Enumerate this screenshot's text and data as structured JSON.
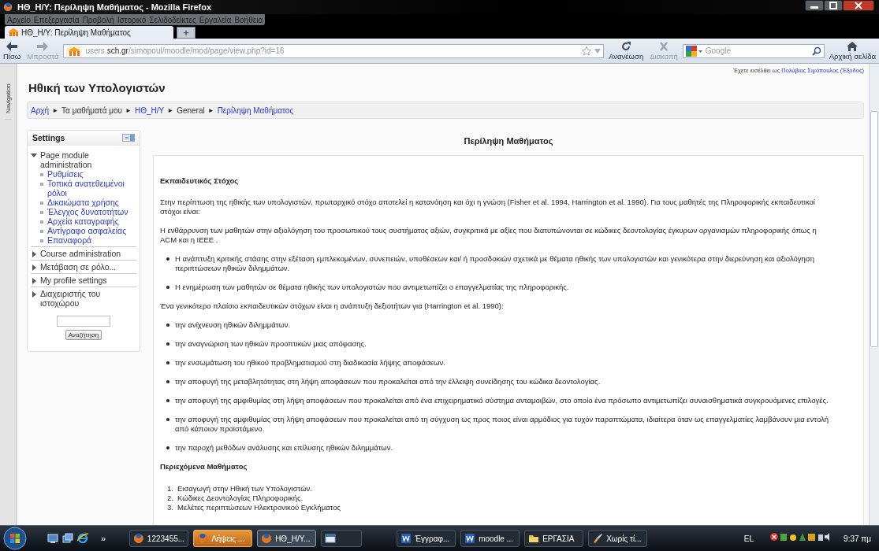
{
  "window": {
    "title": "ΗΘ_Η/Υ: Περίληψη Μαθήματος - Mozilla Firefox"
  },
  "menu_bar": [
    "Αρχείο",
    "Επεξεργασία",
    "Προβολή",
    "Ιστορικό",
    "Σελιδοδείκτες",
    "Εργαλεία",
    "Βοήθεια"
  ],
  "tabs": [
    {
      "label": "ΗΘ_Η/Υ: Περίληψη Μαθήματος",
      "selected": true
    }
  ],
  "new_tab": "+",
  "toolbar": {
    "back": {
      "label": "Πίσω",
      "disabled": false
    },
    "forward": {
      "label": "Μπροστά",
      "disabled": true
    },
    "address": {
      "host_prefix": "users.",
      "host": "sch.gr",
      "path": "/simopoul/moodle/mod/page/view.php?id=16"
    },
    "reload": {
      "label": "Ανανέωση",
      "disabled": false
    },
    "stop": {
      "label": "Διακοπή",
      "disabled": true
    },
    "search": {
      "placeholder": "Google"
    },
    "home": {
      "label": "Αρχική σελίδα"
    }
  },
  "side_tab": "Navigation",
  "site_title": "Ηθική των Υπολογιστών",
  "login": {
    "before": "Έχετε εισέλθει ως",
    "user": "Πολύβιος Σιμόπουλος",
    "open": "(",
    "logout": "Έξοδος",
    "close": ")"
  },
  "breadcrumb": [
    {
      "text": "Αρχή",
      "kind": "link"
    },
    {
      "text": "►",
      "kind": "separator"
    },
    {
      "text": "Τα μαθήματά μου",
      "kind": "text"
    },
    {
      "text": "►",
      "kind": "separator"
    },
    {
      "text": "ΗΘ_Η/Υ",
      "kind": "link"
    },
    {
      "text": "►",
      "kind": "separator"
    },
    {
      "text": "General",
      "kind": "text"
    },
    {
      "text": "►",
      "kind": "separator"
    },
    {
      "text": "Περίληψη Μαθήματος",
      "kind": "link"
    }
  ],
  "settings": {
    "title": "Settings",
    "items": [
      {
        "label": "Page module administration",
        "expanded": true,
        "children": [
          {
            "label": "Ρυθμίσεις"
          },
          {
            "label": "Τοπικά ανατεθειμένοι ρόλοι"
          },
          {
            "label": "Δικαιώματα χρήσης"
          },
          {
            "label": "Έλεγχος δυνατοτήτων"
          },
          {
            "label": "Αρχεία καταγραφής"
          },
          {
            "label": "Αντίγραφο ασφαλείας"
          },
          {
            "label": "Επαναφορά"
          }
        ]
      },
      {
        "label": "Course administration",
        "expanded": false
      },
      {
        "label": "Μετάβαση σε ρόλο...",
        "expanded": false
      },
      {
        "label": "My profile settings",
        "expanded": false
      },
      {
        "label": "Διαχειριστής του ιστοχώρου",
        "expanded": false
      }
    ],
    "search_button": "Αναζήτηση"
  },
  "content": {
    "title": "Περίληψη Μαθήματος",
    "blocks": [
      {
        "kind": "heading",
        "text": "Εκπαιδευτικός Στόχος"
      },
      {
        "kind": "paragraph",
        "text": "Στην περίπτωση της ηθικής των υπολογιστών, πρωταρχικό στόχο αποτελεί η κατανόηση και όχι η γνώση (Fisher et al. 1994, Harrington et al. 1990). Για τους μαθητές της Πληροφορικής εκπαιδευτικοί στόχοι είναι:"
      },
      {
        "kind": "paragraph",
        "text": "Η ενθάρρυνση των μαθητών στην αξιολόγηση του προσωπικού τους συστήματος αξιών, συγκριτικά με αξίες που διατυπώνονται σε κώδικες δεοντολογίας έγκυρων οργανισμών πληροφορικής όπως η ACM και η IEEE ."
      },
      {
        "kind": "bullets",
        "items": [
          "Η ανάπτυξη κριτικής στάσης στην εξέταση εμπλεκομένων, συνεπειών, υποθέσεων και/ ή προσδοκιών σχετικά με θέματα ηθικής των υπολογιστών και γενικότερα στην διερεύνηση και αξιολόγηση περιπτώσεων ηθικών διλημμάτων.",
          "Η ενημέρωση των μαθητών σε θέματα ηθικής των υπολογιστών που αντιμετωπίζει ο επαγγελματίας της πληροφορικής."
        ]
      },
      {
        "kind": "paragraph",
        "text": "Ένα γενικότερο πλαίσιο εκπαιδευτικών στόχων είναι η ανάπτυξη δεξιοτήτων για (Harrington et al. 1990):"
      },
      {
        "kind": "bullets",
        "items": [
          "την ανίχνευση ηθικών διλημμάτων.",
          "την αναγνώριση των ηθικών προοπτικών μιας απόφασης.",
          "την ενσωμάτωση του ηθικού προβληματισμού στη διαδικασία λήψης αποφάσεων.",
          "την αποφυγή της μεταβλητότητας στη λήψη αποφάσεων που προκαλείται από την έλλειψη συνείδησης του κώδικα δεοντολογίας.",
          "την αποφυγή της αμφιθυμίας στη λήψη αποφάσεων που προκαλείται από ένα επιχειρηματικό σύστημα ανταμοιβών, στο οποίο ένα πρόσωπο αντιμετωπίζει συναισθηματικά συγκρουόμενες επιλογές.",
          "την αποφυγή της αμφιθυμίας στη λήψη αποφάσεων που προκαλείται από τη σύγχυση ως προς ποιος είναι αρμόδιος για τυχόν παραπτώματα, ιδιαίτερα όταν ως επαγγελματίες λαμβάνουν μια εντολή από κάποιον προϊστάμενο.",
          "την παροχή μεθόδων ανάλυσης και επίλυσης ηθικών διλημμάτων."
        ]
      },
      {
        "kind": "heading",
        "text": "Περιεχόμενα Μαθήματος"
      },
      {
        "kind": "numbered",
        "items": [
          {
            "number": "1.",
            "text": "Εισαγωγή στην Ηθική των Υπολογιστών."
          },
          {
            "number": "2.",
            "text": "Κώδικες Δεοντολογίας Πληροφορικής."
          },
          {
            "number": "3.",
            "text": "Μελέτες περιπτώσεων Ηλεκτρονικού Εγκλήματος"
          }
        ]
      }
    ]
  },
  "taskbar": {
    "more": "»",
    "tasks": [
      {
        "label": "1223455...",
        "kind": "browser",
        "active": false,
        "flashing": false
      },
      {
        "label": "Λήψεις ...",
        "kind": "browser",
        "active": false,
        "flashing": true
      },
      {
        "label": "ΗΘ_Η/Υ...",
        "kind": "browser",
        "active": true,
        "flashing": false
      },
      {
        "kind": "window",
        "active": false,
        "flashing": false
      },
      {
        "label": "Έγγραφ...",
        "kind": "word",
        "active": false,
        "flashing": false
      },
      {
        "label": "moodle ...",
        "kind": "word",
        "active": false,
        "flashing": false
      },
      {
        "label": "ΕΡΓΑΣΙΑ",
        "kind": "folder",
        "active": false,
        "flashing": false
      },
      {
        "label": "Χωρίς τί...",
        "kind": "paint",
        "active": false,
        "flashing": false
      }
    ],
    "language": "EL",
    "clock": "9:37 πμ"
  }
}
